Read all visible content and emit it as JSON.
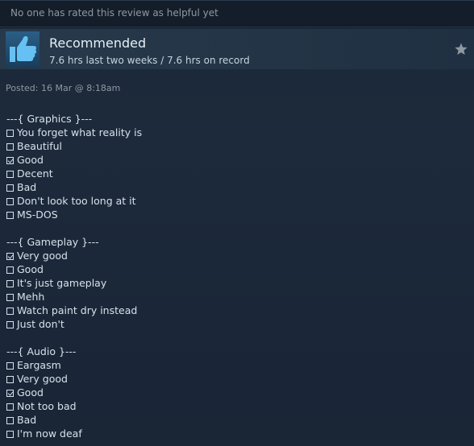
{
  "helpful_text": "No one has rated this review as helpful yet",
  "review": {
    "verdict": "Recommended",
    "hours": "7.6 hrs last two weeks / 7.6 hrs on record",
    "posted": "Posted: 16 Mar @ 8:18am"
  },
  "sections": [
    {
      "heading": "---{ Graphics }---",
      "options": [
        {
          "label": "You forget what reality is",
          "checked": false
        },
        {
          "label": "Beautiful",
          "checked": false
        },
        {
          "label": "Good",
          "checked": true
        },
        {
          "label": "Decent",
          "checked": false
        },
        {
          "label": "Bad",
          "checked": false
        },
        {
          "label": "Don't look too long at it",
          "checked": false
        },
        {
          "label": "MS-DOS",
          "checked": false
        }
      ]
    },
    {
      "heading": "---{ Gameplay }---",
      "options": [
        {
          "label": "Very good",
          "checked": true
        },
        {
          "label": "Good",
          "checked": false
        },
        {
          "label": "It's just gameplay",
          "checked": false
        },
        {
          "label": "Mehh",
          "checked": false
        },
        {
          "label": "Watch paint dry instead",
          "checked": false
        },
        {
          "label": "Just don't",
          "checked": false
        }
      ]
    },
    {
      "heading": "---{ Audio }---",
      "options": [
        {
          "label": "Eargasm",
          "checked": false
        },
        {
          "label": "Very good",
          "checked": false
        },
        {
          "label": "Good",
          "checked": true
        },
        {
          "label": "Not too bad",
          "checked": false
        },
        {
          "label": "Bad",
          "checked": false
        },
        {
          "label": "I'm now deaf",
          "checked": false
        }
      ]
    }
  ],
  "icons": {
    "thumb": "thumbs-up-icon",
    "star": "star-icon"
  },
  "colors": {
    "background": "#1b2838",
    "accent_blue": "#66c0f4",
    "muted_text": "#8f98a0"
  }
}
